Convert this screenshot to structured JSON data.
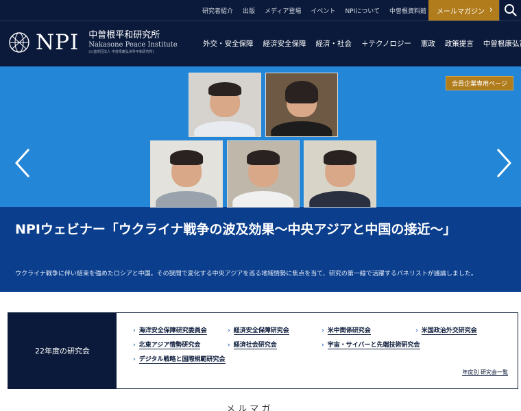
{
  "header": {
    "util_links": [
      "研究者紹介",
      "出版",
      "メディア登場",
      "イベント",
      "NPIについて",
      "中曽根資料館"
    ],
    "mail_label": "メールマガジン",
    "logo_mark": "NPI",
    "logo_jp": "中曽根平和研究所",
    "logo_en": "Nakasone Peace Institute",
    "logo_sub": "(公益財団法人 中曽根康弘世界平和研究所)",
    "nav": [
      "外交・安全保障",
      "経済安全保障",
      "経済・社会",
      "＋テクノロジー",
      "憲政",
      "政策提言",
      "中曽根康弘賞"
    ]
  },
  "hero": {
    "member_label": "会員企業専用ページ",
    "title": "NPIウェビナー「ウクライナ戦争の波及効果～中央アジアと中国の接近～」",
    "description": "ウクライナ戦争に伴い結束を強めたロシアと中国。その狭間で変化する中央アジアを巡る地域情勢に焦点を当て、研究の第一線で活躍するパネリストが議論しました。"
  },
  "research": {
    "label": "22年度の研究会",
    "links": [
      "海洋安全保障研究委員会",
      "経済安全保障研究会",
      "米中関係研究会",
      "米国政治外交研究会",
      "北東アジア情勢研究会",
      "経済社会研究会",
      "宇宙・サイバーと先端技術研究会",
      "デジタル戦略と国際規範研究会"
    ],
    "year_link": "年度別 研究会一覧"
  },
  "bottom_peek": "メ ル マ ガ"
}
